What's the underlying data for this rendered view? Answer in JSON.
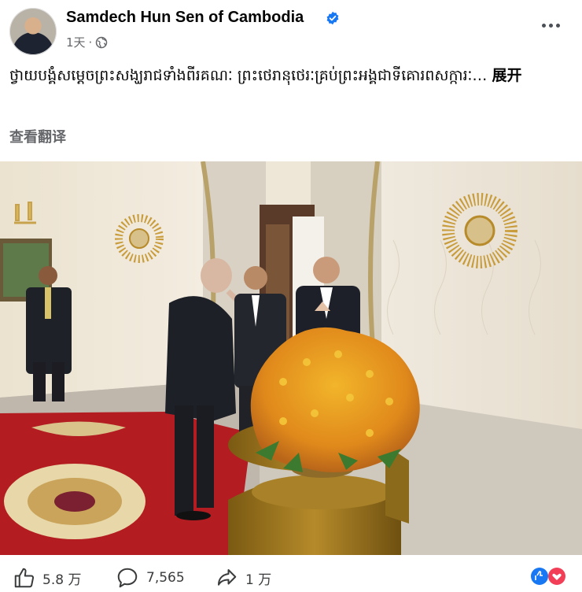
{
  "post": {
    "author": "Samdech Hun Sen of Cambodia",
    "time": "1天",
    "caption_text": "ថ្វាយបង្គំសម្តេចព្រះសង្ឃរាជទាំងពីរគណៈ ព្រះថេរានុថេរៈគ្រប់ព្រះអង្គជាទីគោរពសក្ការៈ… ",
    "expand_label": "展开",
    "translate_label": "查看翻译"
  },
  "photo": {
    "description_icon": "photo"
  },
  "footer": {
    "likes": "5.8 万",
    "comments": "7,565",
    "shares": "1 万"
  },
  "colors": {
    "verified": "#1877f2",
    "meta_gray": "#65676b"
  }
}
